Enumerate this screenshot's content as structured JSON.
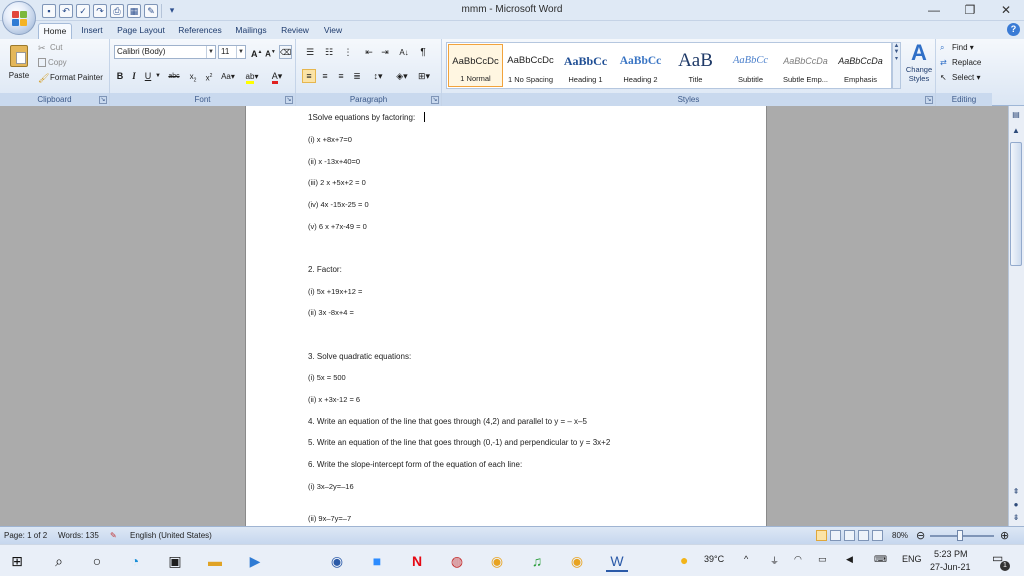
{
  "window": {
    "title": "mmm - Microsoft Word",
    "minimize": "—",
    "restore": "❐",
    "close": "✕"
  },
  "tabs": [
    "Home",
    "Insert",
    "Page Layout",
    "References",
    "Mailings",
    "Review",
    "View"
  ],
  "ribbon": {
    "clipboard": {
      "paste": "Paste",
      "cut": "Cut",
      "copy": "Copy",
      "format_painter": "Format Painter",
      "label": "Clipboard"
    },
    "font": {
      "family": "Calibri (Body)",
      "size": "11",
      "label": "Font"
    },
    "paragraph": {
      "label": "Paragraph"
    },
    "styles": {
      "label": "Styles",
      "change_styles": "Change Styles",
      "items": [
        {
          "sample": "AaBbCcDc",
          "name": "1 Normal"
        },
        {
          "sample": "AaBbCcDc",
          "name": "1 No Spacing"
        },
        {
          "sample": "AaBbCc",
          "name": "Heading 1"
        },
        {
          "sample": "AaBbCc",
          "name": "Heading 2"
        },
        {
          "sample": "AaB",
          "name": "Title"
        },
        {
          "sample": "AaBbCc",
          "name": "Subtitle"
        },
        {
          "sample": "AaBbCcDa",
          "name": "Subtle Emp..."
        },
        {
          "sample": "AaBbCcDa",
          "name": "Emphasis"
        }
      ]
    },
    "editing": {
      "find": "Find",
      "replace": "Replace",
      "select": "Select",
      "label": "Editing"
    }
  },
  "document": {
    "lines": [
      "1Solve equations by factoring:",
      "(i) x +8x+7=0",
      "(ii) x -13x+40=0",
      "(iii) 2 x +5x+2 = 0",
      "(iv) 4x -15x-25 = 0",
      "(v) 6 x +7x-49 = 0",
      "2. Factor:",
      "(i) 5x +19x+12 =",
      "(ii) 3x -8x+4 =",
      "3. Solve quadratic equations:",
      "(i) 5x = 500",
      "(ii) x +3x-12 = 6",
      "4. Write an equation of the line that goes through (4,2) and parallel to y = – x–5",
      "5. Write an equation of the line that goes through (0,-1) and perpendicular to y = 3x+2",
      "6. Write the slope-intercept form of the equation of each line:",
      "(i) 3x–2y=–16",
      "(ii) 9x–7y=–7"
    ]
  },
  "status": {
    "page": "Page: 1 of 2",
    "words": "Words: 135",
    "language": "English (United States)",
    "zoom": "80%"
  },
  "taskbar": {
    "weather": "39°C",
    "language": "ENG",
    "time": "5:23 PM",
    "date": "27-Jun-21",
    "notifications": "1"
  }
}
